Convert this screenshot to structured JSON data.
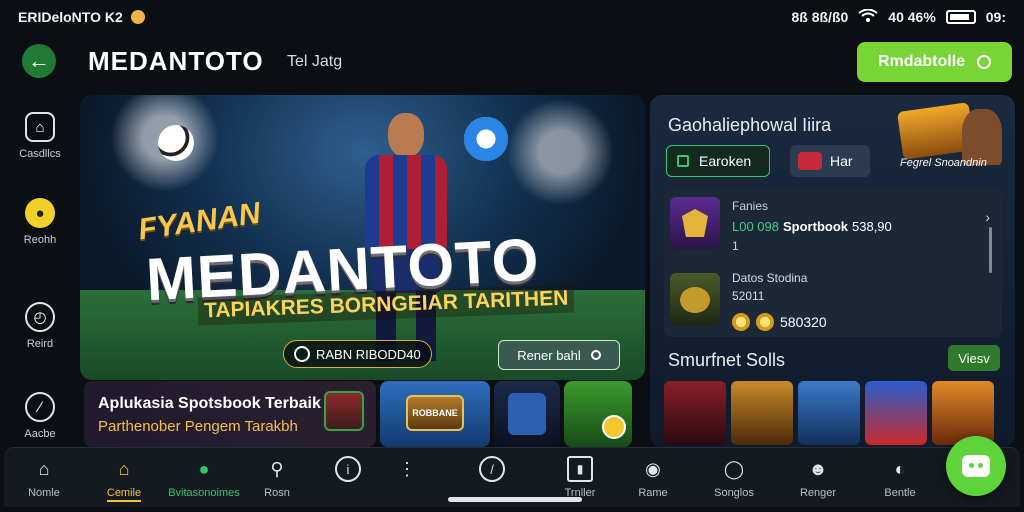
{
  "status_bar": {
    "left_text": "ERIDeloNTO K2",
    "right_text": "8ß 8ß/ß0",
    "battery": "40 46%",
    "time": "09:"
  },
  "header": {
    "title": "MEDANTOTO",
    "subtitle": "Tel Jatg",
    "cta_label": "Rmdabtolle"
  },
  "rail": {
    "items": [
      {
        "label": "Casdllcs",
        "icon": "home-icon"
      },
      {
        "label": "Reohh",
        "icon": "coin-icon"
      },
      {
        "label": "Reird",
        "icon": "timer-icon"
      },
      {
        "label": "Aacbe",
        "icon": "compass-icon"
      }
    ]
  },
  "hero": {
    "title_small": "FYANAN",
    "title_big": "MEDANTOTO",
    "tagline": "TAPIAKRES BORNGEIAR TARITHEN",
    "pill_label": "RABN RIBODD40",
    "button_label": "Rener bahl"
  },
  "promo": {
    "line1": "Aplukasia Spotsbook Terbaik",
    "line2": "Parthenober Pengem Tarakbh"
  },
  "tiles": {
    "tile1_label": "ROBBANE"
  },
  "right_panel": {
    "title": "Gaohaliephowal Iiira",
    "chip1": "Earoken",
    "chip2": "Har",
    "badge_caption": "Fegrel Snoandnin",
    "card": {
      "row1_label": "Fanies",
      "row1_code": "L00 098",
      "row1_product": "Sportbook",
      "row1_amount": "538,90",
      "row1_sub": "1",
      "row2_label": "Datos Stodina",
      "row2_value": "52011",
      "row2_coins": "580320"
    },
    "section_title": "Smurfnet Solls",
    "view_label": "Viesv"
  },
  "bottom_nav": {
    "items": [
      {
        "label": "Nomle",
        "icon": "home-icon"
      },
      {
        "label": "Cemile",
        "icon": "house-icon"
      },
      {
        "label": "Bvitasonoimes",
        "icon": "chat-icon"
      },
      {
        "label": "Rosn",
        "icon": "search-icon"
      },
      {
        "label": "",
        "icon": "info-icon"
      },
      {
        "label": "",
        "icon": "dots-icon"
      },
      {
        "label": "",
        "icon": "clock-icon"
      },
      {
        "label": "Trnller",
        "icon": "ticket-icon"
      },
      {
        "label": "Rame",
        "icon": "gamepad-icon"
      },
      {
        "label": "Songlos",
        "icon": "shield-icon"
      },
      {
        "label": "Renger",
        "icon": "user-icon"
      },
      {
        "label": "Bentle",
        "icon": "gauge-icon"
      }
    ]
  },
  "colors": {
    "accent_green": "#79d435",
    "active_yellow": "#f7c23a",
    "background": "#0b0f14"
  }
}
